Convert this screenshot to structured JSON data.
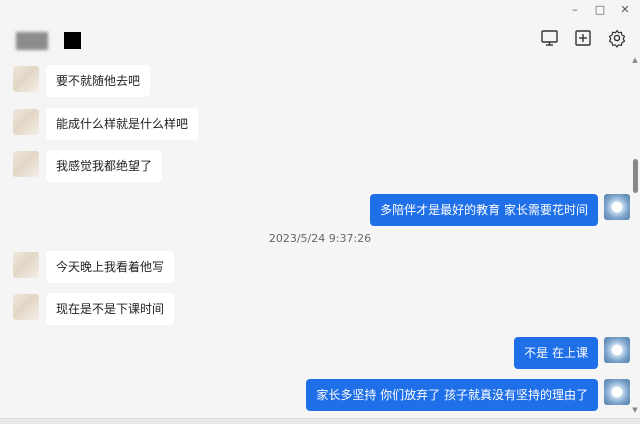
{
  "window": {
    "minimize_glyph": "–",
    "maximize_glyph": "□",
    "close_glyph": "✕"
  },
  "toolbar": {
    "icons": [
      "screen-share-icon",
      "add-chat-icon",
      "settings-gear-icon"
    ]
  },
  "messages": [
    {
      "direction": "in",
      "text": "要不就随他去吧"
    },
    {
      "direction": "in",
      "text": "能成什么样就是什么样吧"
    },
    {
      "direction": "in",
      "text": "我感觉我都绝望了"
    },
    {
      "direction": "out",
      "text": "多陪伴才是最好的教育 家长需要花时间"
    },
    {
      "direction": "in",
      "text": "今天晚上我看着他写"
    },
    {
      "direction": "in",
      "text": "现在是不是下课时间"
    },
    {
      "direction": "out",
      "text": "不是  在上课"
    },
    {
      "direction": "out",
      "text": "家长多坚持 你们放弃了 孩子就真没有坚持的理由了"
    }
  ],
  "timestamp": "2023/5/24 9:37:26",
  "colors": {
    "outgoing_bubble": "#1f6fe8",
    "incoming_bubble": "#ffffff",
    "background": "#f5f5f5"
  }
}
